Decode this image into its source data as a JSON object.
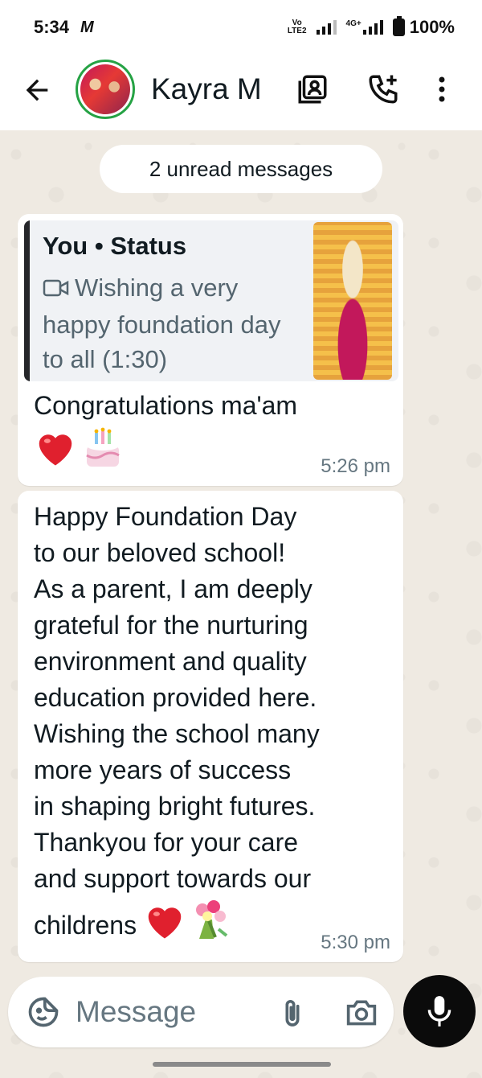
{
  "status_bar": {
    "time": "5:34",
    "carrier_logo": "M",
    "volte_line1": "Vo",
    "volte_line2": "LTE2",
    "network_type": "4G+",
    "battery": "100%"
  },
  "header": {
    "contact_name": "Kayra M",
    "icons": [
      "back-arrow-icon",
      "contact-card-icon",
      "add-call-icon",
      "more-vert-icon"
    ]
  },
  "chat": {
    "unread_banner": "2 unread messages",
    "messages": [
      {
        "quote_title": "You • Status",
        "quote_text": "Wishing a very happy foundation day to all (1:30)",
        "text": "Congratulations ma'am",
        "emojis": [
          "heart-emoji",
          "birthday-cake-emoji"
        ],
        "time": "5:26 pm"
      },
      {
        "text": "Happy Foundation Day\nto our beloved school!\nAs a parent, I am deeply\ngrateful for the nurturing\nenvironment and quality\neducation provided here.\nWishing the school many\nmore years of success\nin shaping bright futures.\nThankyou for your care\nand support towards our\nchildrens",
        "emojis": [
          "heart-emoji",
          "bouquet-emoji"
        ],
        "time": "5:30 pm"
      }
    ]
  },
  "composer": {
    "placeholder": "Message"
  },
  "colors": {
    "chat_background": "#efeae2",
    "bubble": "#ffffff",
    "avatar_ring": "#25a244",
    "mic_button": "#0b0b0b"
  }
}
